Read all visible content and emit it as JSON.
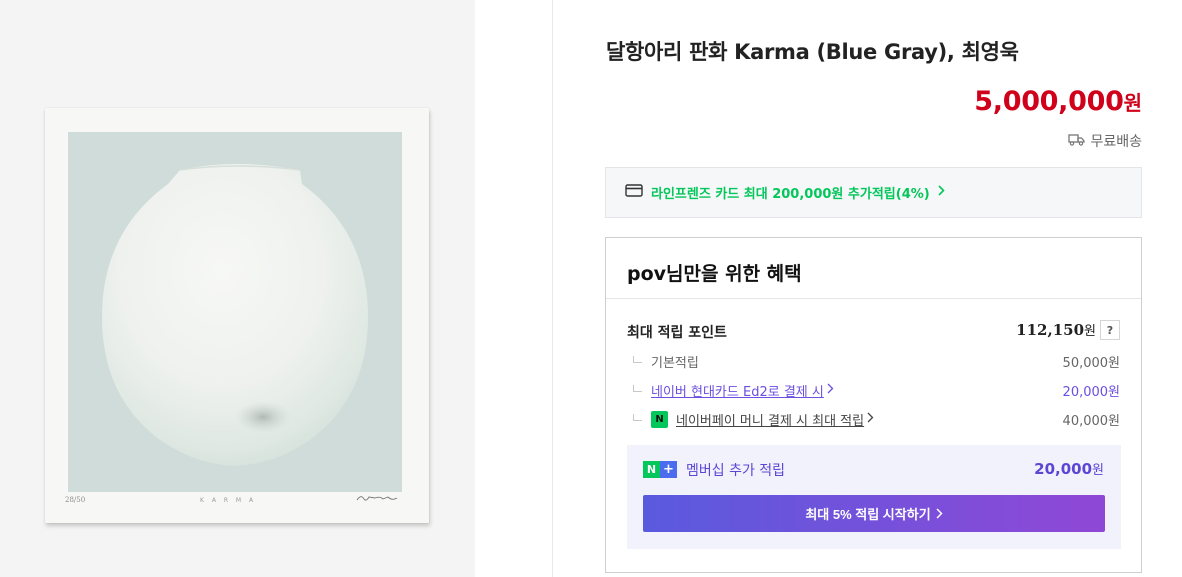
{
  "artwork": {
    "edition": "28/50",
    "title_inscription": "K A R M A"
  },
  "product": {
    "title": "달항아리 판화 Karma (Blue Gray), 최영욱",
    "price": "5,000,000",
    "price_unit": "원",
    "shipping": "무료배송"
  },
  "card_promo": {
    "text": "라인프렌즈 카드 최대 200,000원 추가적립(4%)"
  },
  "benefit": {
    "title": "pov님만을 위한 혜택",
    "max_points_label": "최대 적립 포인트",
    "max_points_value": "112,150",
    "max_points_unit": "원",
    "help_label": "?",
    "rows": [
      {
        "label": "기본적립",
        "value": "50,000원"
      },
      {
        "label": "네이버 현대카드 Ed2로 결제 시",
        "value": "20,000원"
      },
      {
        "label": "네이버페이 머니 결제 시 최대 적립",
        "value": "40,000원"
      }
    ],
    "npay_icon_text": "N",
    "membership": {
      "badge_n": "N",
      "badge_plus": "+",
      "label": "멤버십 추가 적립",
      "value": "20,000",
      "unit": "원",
      "cta": "최대 5% 적립 시작하기"
    }
  },
  "icons": {
    "truck": "truck-icon",
    "card": "credit-card-icon",
    "chevron": "chevron-right-icon"
  },
  "colors": {
    "price_red": "#d0021b",
    "naver_green": "#03c75a",
    "membership_purple": "#5b46d6",
    "cta_gradient_start": "#5a5ade",
    "cta_gradient_end": "#8f48d6"
  }
}
